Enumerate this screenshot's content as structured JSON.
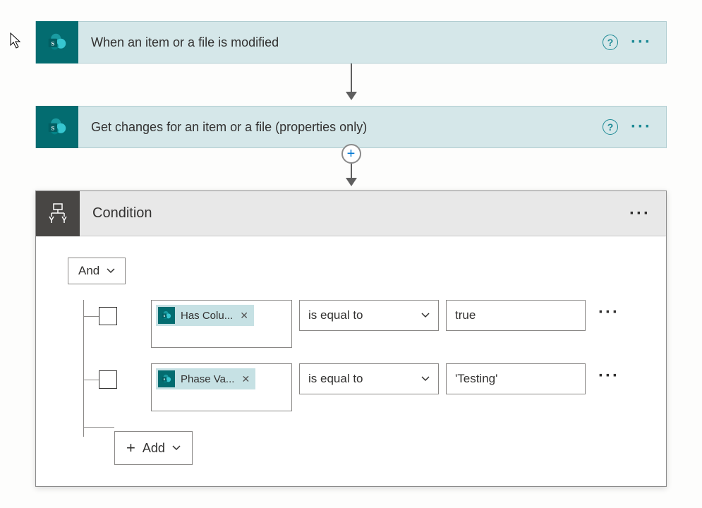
{
  "trigger": {
    "title": "When an item or a file is modified"
  },
  "action1": {
    "title": "Get changes for an item or a file (properties only)"
  },
  "condition": {
    "title": "Condition",
    "groupOperator": "And",
    "addLabel": "Add",
    "rules": [
      {
        "token": "Has Colu...",
        "operator": "is equal to",
        "value": "true"
      },
      {
        "token": "Phase Va...",
        "operator": "is equal to",
        "value": "'Testing'"
      }
    ]
  }
}
